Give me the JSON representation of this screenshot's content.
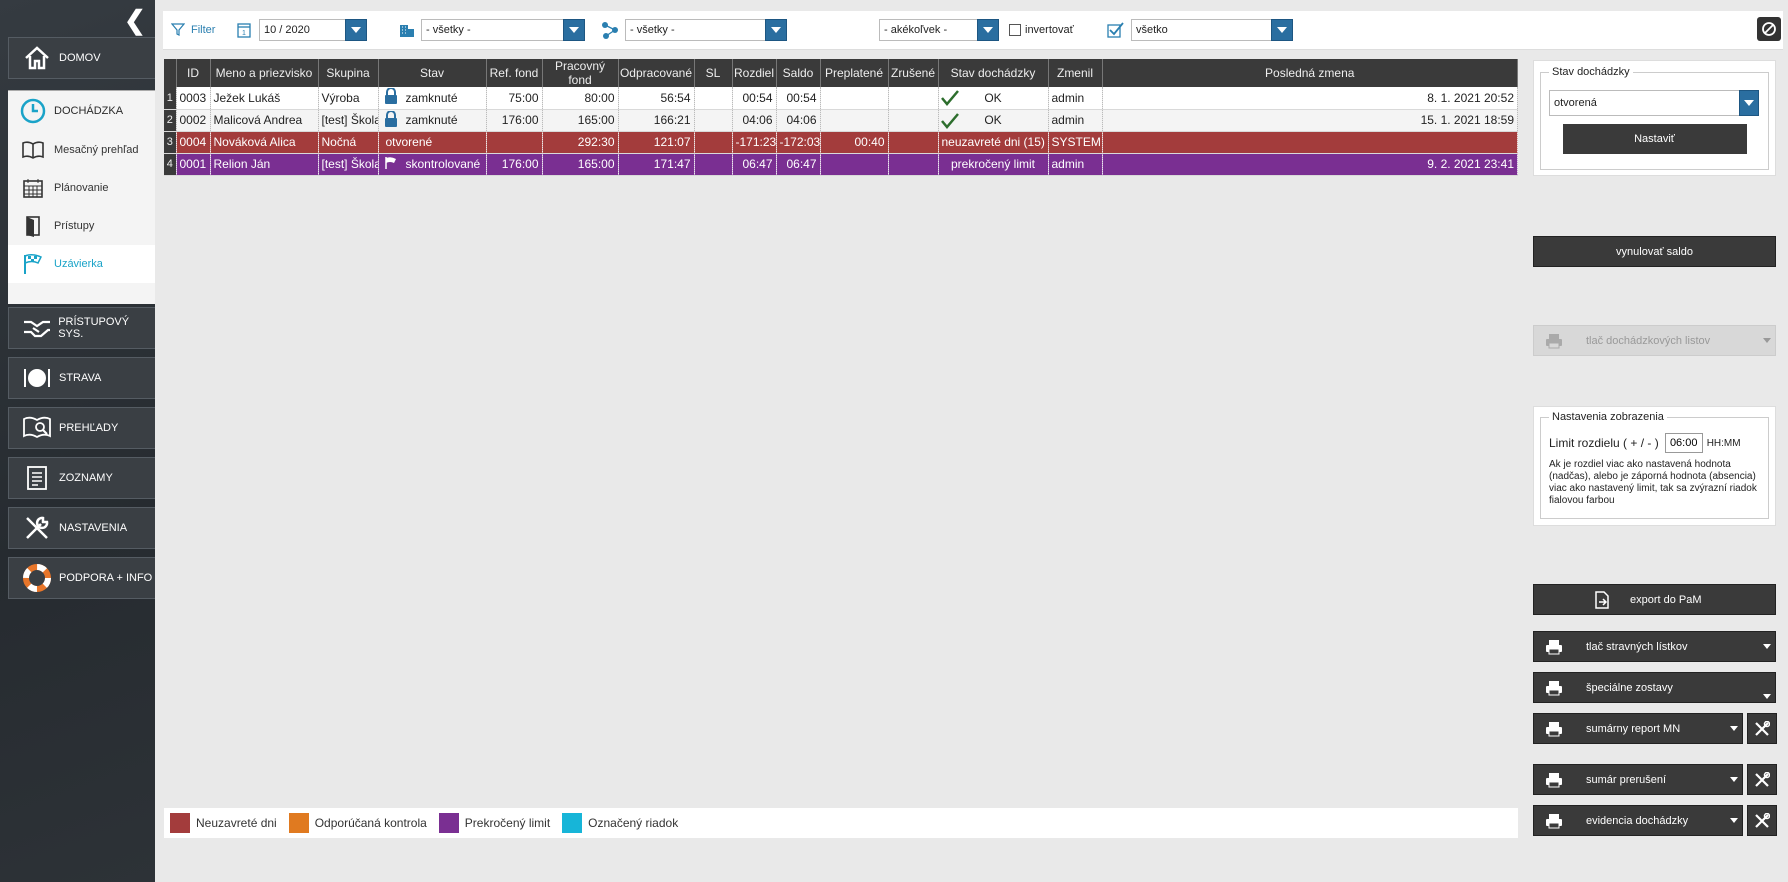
{
  "sidebar": {
    "modules_top": [
      {
        "label": "DOMOV",
        "icon": "home-icon"
      }
    ],
    "group_header": {
      "label": "DOCHÁDZKA",
      "icon": "clock-icon"
    },
    "group_items": [
      {
        "label": "Mesačný prehľad",
        "icon": "book-icon"
      },
      {
        "label": "Plánovanie",
        "icon": "calendar-icon"
      },
      {
        "label": "Prístupy",
        "icon": "door-icon"
      },
      {
        "label": "Uzávierka",
        "icon": "checkered-flag-icon"
      }
    ],
    "modules_bottom": [
      {
        "label": "PRÍSTUPOVÝ SYS.",
        "icon": "handshake-icon"
      },
      {
        "label": "STRAVA",
        "icon": "plate-icon"
      },
      {
        "label": "PREHĽADY",
        "icon": "magnifier-book-icon"
      },
      {
        "label": "ZOZNAMY",
        "icon": "list-icon"
      },
      {
        "label": "NASTAVENIA",
        "icon": "tools-icon"
      },
      {
        "label": "PODPORA + INFO",
        "icon": "lifebuoy-icon"
      }
    ]
  },
  "filter": {
    "label": "Filter",
    "period": "10 / 2020",
    "department": "- všetky -",
    "group": "- všetky -",
    "any": "- akékoľvek -",
    "invert_label": "invertovať",
    "state": "všetko"
  },
  "table": {
    "headers": [
      "",
      "ID",
      "Meno a priezvisko",
      "Skupina",
      "Stav",
      "Ref. fond",
      "Pracovný fond",
      "Odpracované",
      "SL",
      "Rozdiel",
      "Saldo",
      "Preplatené",
      "Zrušené",
      "Stav dochádzky",
      "Zmenil",
      "Posledná zmena"
    ],
    "rows": [
      {
        "n": "1",
        "id": "0003",
        "name": "Ježek Lukáš",
        "group": "Výroba",
        "state_icon": "lock-icon",
        "state": "zamknuté",
        "ref": "75:00",
        "work": "80:00",
        "done": "56:54",
        "sl": "",
        "diff": "00:54",
        "saldo": "00:54",
        "paid": "",
        "cancel": "",
        "att_icon": "check-icon",
        "att": "OK",
        "by": "admin",
        "last": "8. 1. 2021 20:52",
        "style": "r"
      },
      {
        "n": "2",
        "id": "0002",
        "name": "Malicová Andrea",
        "group": "[test] Škola",
        "state_icon": "lock-icon",
        "state": "zamknuté",
        "ref": "176:00",
        "work": "165:00",
        "done": "166:21",
        "sl": "",
        "diff": "04:06",
        "saldo": "04:06",
        "paid": "",
        "cancel": "",
        "att_icon": "check-icon",
        "att": "OK",
        "by": "admin",
        "last": "15. 1. 2021 18:59",
        "style": "r alt"
      },
      {
        "n": "3",
        "id": "0004",
        "name": "Nováková Alica",
        "group": "Nočná",
        "state_icon": "",
        "state": "otvorené",
        "ref": "",
        "work": "292:30",
        "done": "121:07",
        "sl": "",
        "diff": "-171:23",
        "saldo": "-172:03",
        "paid": "00:40",
        "cancel": "",
        "att_icon": "",
        "att": "neuzavreté dni (15)",
        "by": "SYSTEM",
        "last": "",
        "style": "red"
      },
      {
        "n": "4",
        "id": "0001",
        "name": "Relion Ján",
        "group": "[test] Škola",
        "state_icon": "flag-icon",
        "state": "skontrolované",
        "ref": "176:00",
        "work": "165:00",
        "done": "171:47",
        "sl": "",
        "diff": "06:47",
        "saldo": "06:47",
        "paid": "",
        "cancel": "",
        "att_icon": "",
        "att": "prekročený limit",
        "by": "admin",
        "last": "9. 2. 2021 23:41",
        "style": "pur"
      }
    ]
  },
  "legend": [
    {
      "label": "Neuzavreté dni",
      "color": "#a33c3c"
    },
    {
      "label": "Odporúčaná kontrola",
      "color": "#e07a20"
    },
    {
      "label": "Prekročený limit",
      "color": "#7a2f92"
    },
    {
      "label": "Označený riadok",
      "color": "#17b5d8"
    }
  ],
  "right": {
    "state_panel": {
      "legend": "Stav dochádzky",
      "select": "otvorená",
      "button": "Nastaviť"
    },
    "reset_saldo": "vynulovať saldo",
    "print_sheets": "tlač dochádzkových listov",
    "display_panel": {
      "legend": "Nastavenia zobrazenia",
      "limit_label": "Limit rozdielu ( + / - )",
      "limit_value": "06:00",
      "unit": "HH:MM",
      "note": "Ak je rozdiel viac ako nastavená hodnota (nadčas), alebo je záporná hodnota (absencia) viac ako nastavený limit, tak sa zvýrazní riadok fialovou farbou"
    },
    "export": "export do PaM",
    "meal_tickets": "tlač stravných lístkov",
    "special": "špeciálne zostavy",
    "summary_mn": "sumárny report MN",
    "interruptions": "sumár prerušení",
    "attendance_records": "evidencia dochádzky"
  }
}
